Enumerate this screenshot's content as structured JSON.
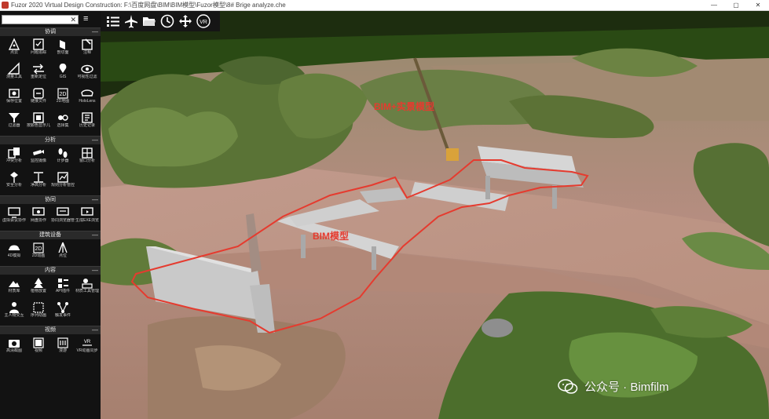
{
  "window": {
    "title": "Fuzor 2020 Virtual Design Construction: F:\\百度网盘\\BIM\\BIM模型\\Fuzor模型\\8# Brige  analyze.che",
    "minimize": "—",
    "maximize": "▢",
    "close": "✕"
  },
  "search": {
    "value": "",
    "placeholder": "",
    "clear": "✕"
  },
  "panel": {
    "sections": [
      {
        "title": "协调",
        "tools": [
          {
            "label": "点云",
            "icon": "point-cloud-icon"
          },
          {
            "label": "问题追踪",
            "icon": "issue-tracking-icon"
          },
          {
            "label": "剖切面",
            "icon": "section-plane-icon"
          },
          {
            "label": "注释",
            "icon": "annotation-icon"
          },
          {
            "label": "测量工具",
            "icon": "measure-icon"
          },
          {
            "label": "重新定位",
            "icon": "relocate-icon"
          },
          {
            "label": "GIS",
            "icon": "gis-icon"
          },
          {
            "label": "可视性过滤",
            "icon": "visibility-filter-icon"
          },
          {
            "label": "保存位置",
            "icon": "save-position-icon"
          },
          {
            "label": "链接文件",
            "icon": "link-file-icon"
          },
          {
            "label": "2D地图",
            "icon": "map-2d-icon"
          },
          {
            "label": "HoloLens",
            "icon": "hololens-icon"
          },
          {
            "label": "过滤器",
            "icon": "filter-icon"
          },
          {
            "label": "按颜色显示几何图形",
            "icon": "color-geometry-icon"
          },
          {
            "label": "选择集",
            "icon": "selection-set-icon"
          },
          {
            "label": "历史记录",
            "icon": "history-icon"
          }
        ]
      },
      {
        "title": "分析",
        "tools": [
          {
            "label": "冲突分析",
            "icon": "clash-analysis-icon"
          },
          {
            "label": "监控摄像",
            "icon": "camera-monitor-icon"
          },
          {
            "label": "计步器",
            "icon": "pedometer-icon"
          },
          {
            "label": "窗口分析",
            "icon": "window-analysis-icon"
          },
          {
            "label": "安全分析",
            "icon": "safety-analysis-icon"
          },
          {
            "label": "净高分析",
            "icon": "clearance-analysis-icon"
          },
          {
            "label": "规则分析管控",
            "icon": "rule-analysis-icon"
          },
          {
            "label": "",
            "icon": "blank"
          }
        ]
      },
      {
        "title": "协同",
        "tools": [
          {
            "label": "虚拟会议协作",
            "icon": "virtual-meeting-icon"
          },
          {
            "label": "网盘协作",
            "icon": "cloud-collab-icon"
          },
          {
            "label": "协同浏览器管理",
            "icon": "collab-browser-icon"
          },
          {
            "label": "生成EXE浏览器",
            "icon": "exe-viewer-icon"
          }
        ]
      },
      {
        "title": "建筑设备",
        "tools": [
          {
            "label": "4D模拟",
            "icon": "sim-4d-icon"
          },
          {
            "label": "2D动画",
            "icon": "animation-2d-icon"
          },
          {
            "label": "点位",
            "icon": "survey-point-icon"
          },
          {
            "label": "",
            "icon": "blank"
          }
        ]
      },
      {
        "title": "内容",
        "tools": [
          {
            "label": "材质库",
            "icon": "material-library-icon"
          },
          {
            "label": "植物放置",
            "icon": "plant-placement-icon"
          },
          {
            "label": "API插件",
            "icon": "api-plugin-icon"
          },
          {
            "label": "材质工具管理",
            "icon": "material-tool-icon"
          },
          {
            "label": "主人物交互",
            "icon": "avatar-icon"
          },
          {
            "label": "序列动画",
            "icon": "sequence-animation-icon"
          },
          {
            "label": "触发事件",
            "icon": "trigger-event-icon"
          },
          {
            "label": "",
            "icon": "blank"
          }
        ]
      },
      {
        "title": "视频",
        "tools": [
          {
            "label": "高清截图",
            "icon": "hd-screenshot-icon"
          },
          {
            "label": "视频",
            "icon": "video-icon"
          },
          {
            "label": "漫游",
            "icon": "walkthrough-icon"
          },
          {
            "label": "VR动画同步",
            "icon": "vr-sync-icon"
          }
        ]
      }
    ],
    "collapse_glyph": "—"
  },
  "toolbar": [
    {
      "name": "list-view-button",
      "icon": "list-icon"
    },
    {
      "name": "fly-mode-button",
      "icon": "airplane-icon"
    },
    {
      "name": "open-folder-button",
      "icon": "folder-icon"
    },
    {
      "name": "time-button",
      "icon": "clock-icon"
    },
    {
      "name": "move-button",
      "icon": "move-icon"
    },
    {
      "name": "vr-button",
      "icon": "vr-icon"
    }
  ],
  "scene": {
    "annotations": [
      {
        "text": "BIM+实景模型"
      },
      {
        "text": "BIM模型"
      }
    ],
    "watermark": "公众号 · Bimfilm",
    "colors": {
      "annotation_red": "#e53b2f",
      "sky": "#223a12",
      "ground": "#b58d80",
      "vegetation": "#5f7a3c",
      "concrete": "#c9c9c9"
    }
  }
}
